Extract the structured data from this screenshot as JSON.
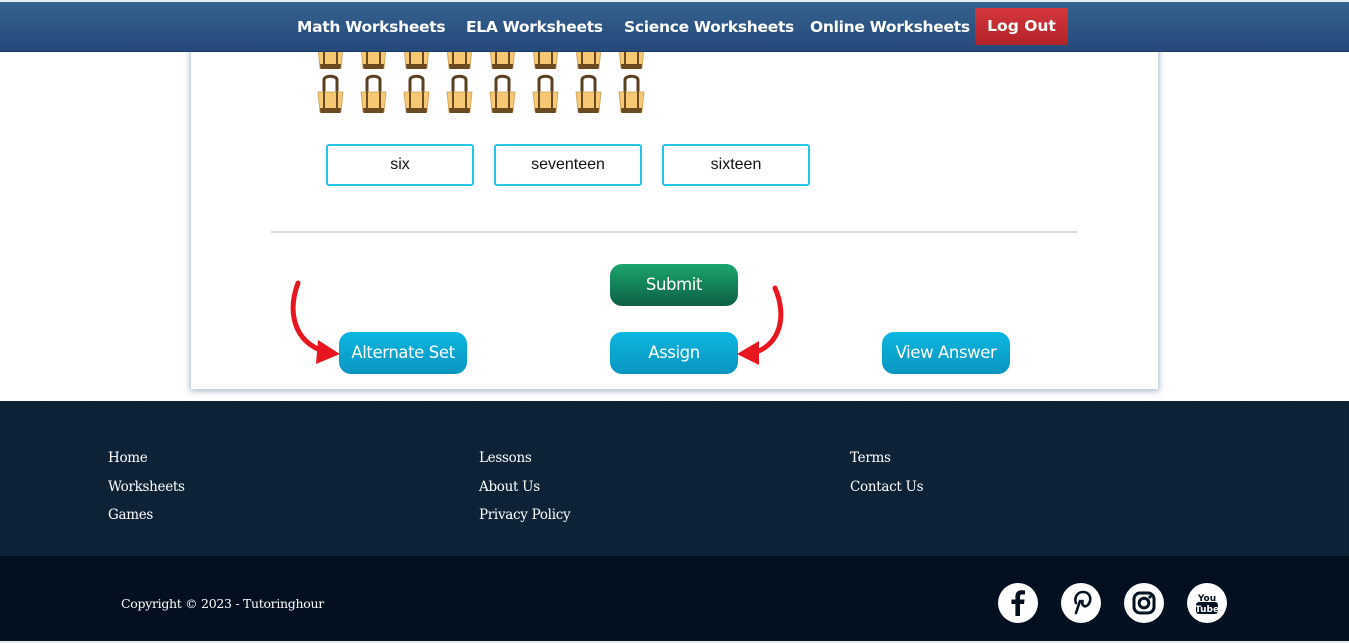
{
  "nav": {
    "items": [
      {
        "label": "Math Worksheets"
      },
      {
        "label": "ELA Worksheets"
      },
      {
        "label": "Science Worksheets"
      },
      {
        "label": "Online Worksheets"
      }
    ],
    "logout_label": "Log Out"
  },
  "question": {
    "image_icon": "tote-bag-icon",
    "visible_rows": 2,
    "bags_per_row": 8
  },
  "options": [
    {
      "label": "six"
    },
    {
      "label": "seventeen"
    },
    {
      "label": "sixteen"
    }
  ],
  "actions": {
    "submit_label": "Submit",
    "alternate_label": "Alternate Set",
    "assign_label": "Assign",
    "view_answer_label": "View Answer"
  },
  "footer": {
    "columns": [
      [
        {
          "label": "Home"
        },
        {
          "label": "Worksheets"
        },
        {
          "label": "Games"
        }
      ],
      [
        {
          "label": "Lessons"
        },
        {
          "label": "About Us"
        },
        {
          "label": "Privacy Policy"
        }
      ],
      [
        {
          "label": "Terms"
        },
        {
          "label": "Contact Us"
        }
      ]
    ],
    "copyright": "Copyright © 2023 - Tutoringhour",
    "social": [
      "facebook-icon",
      "pinterest-icon",
      "instagram-icon",
      "youtube-icon"
    ]
  },
  "colors": {
    "nav_bg": "#2b5380",
    "logout": "#c42c31",
    "option_border": "#25c6ea",
    "submit": "#14875a",
    "blue_button": "#0aa8d3",
    "arrow": "#e8161f",
    "footer_top": "#0f2336",
    "footer_bottom": "#03101f"
  }
}
